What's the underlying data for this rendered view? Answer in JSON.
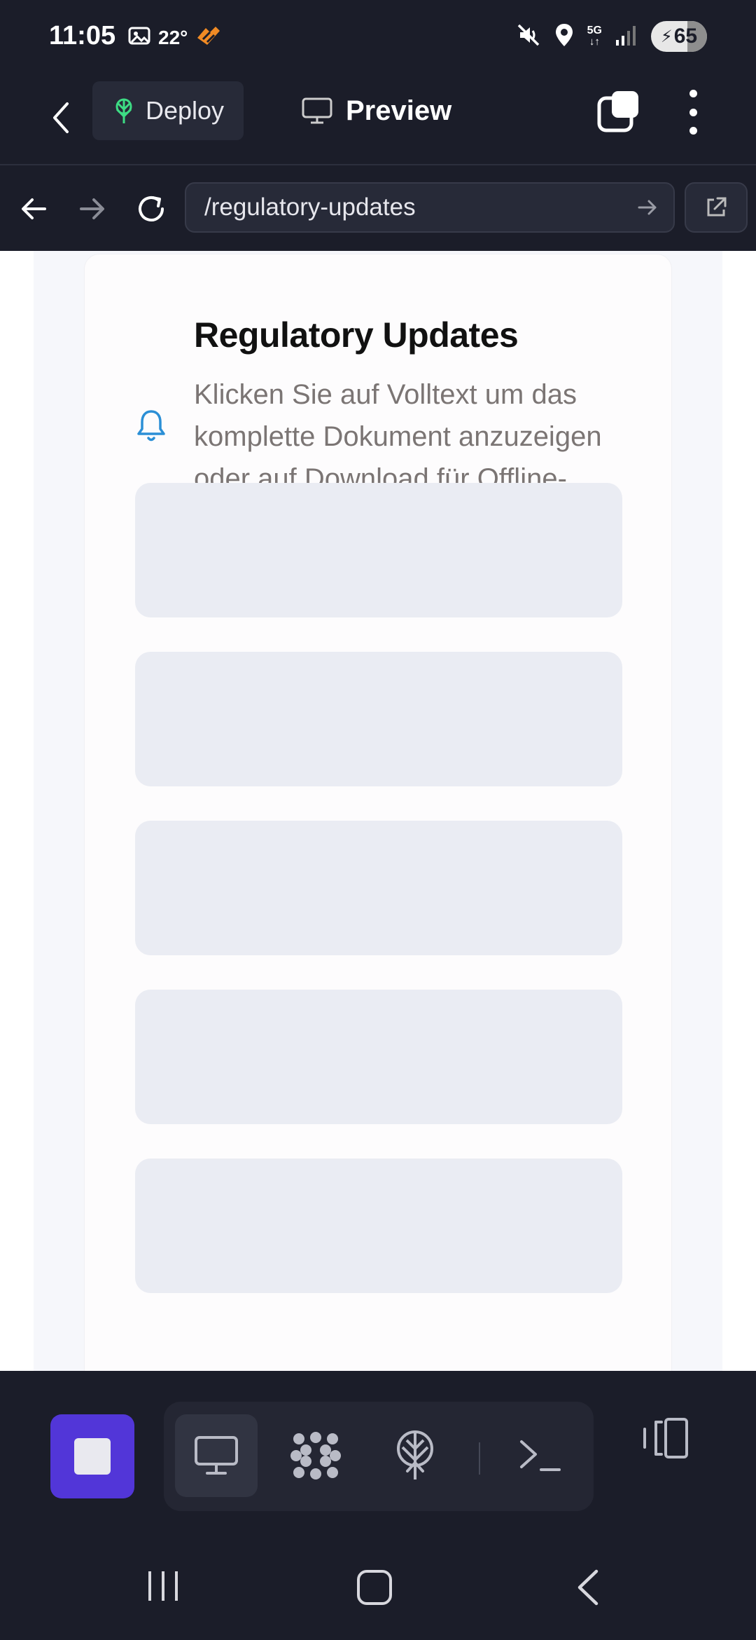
{
  "status_bar": {
    "time": "11:05",
    "temperature": "22°",
    "network": "5G",
    "battery": "65",
    "battery_fraction": 0.65
  },
  "app_bar": {
    "deploy_label": "Deploy",
    "preview_label": "Preview"
  },
  "url_bar": {
    "url": "/regulatory-updates"
  },
  "page": {
    "title": "Regulatory Updates",
    "subtitle": "Klicken Sie auf Volltext um das komplette Dokument anzuzeigen oder auf Download für Offline-Zugriff",
    "skeleton_count": 5
  },
  "toolbar": {
    "tools": [
      "preview-icon",
      "agent-icon",
      "deploy-icon",
      "terminal-icon"
    ],
    "active_tool": "preview-icon"
  },
  "colors": {
    "background": "#1b1d29",
    "accent": "#5236d8",
    "deploy_green": "#3ddc84",
    "bell_blue": "#2b8fd6",
    "skeleton": "#eaecf3"
  }
}
